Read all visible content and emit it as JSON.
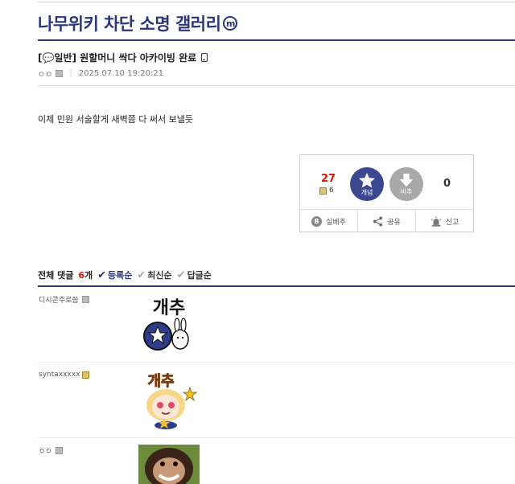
{
  "gallery": {
    "title": "나무위키 차단 소명 갤러리",
    "minor_badge": "m"
  },
  "post": {
    "title": "[💬일반] 원할머니 싹다 아카이빙 완료",
    "author": "ㅇㅇ",
    "date": "2025.07.10 19:20:21",
    "body": "이제 민원 서술할게 새벽쯤 다 써서 보낼듯"
  },
  "vote": {
    "up_count": "27",
    "fix_count": "6",
    "up_label": "개념",
    "down_label": "비추",
    "down_count": "0",
    "actions": [
      "실베추",
      "공유",
      "신고"
    ],
    "bestcheck_letter": "B"
  },
  "comments": {
    "total_label": "전체 댓글",
    "count": "6",
    "count_suffix": "개",
    "sort_options": [
      "등록순",
      "최신순",
      "답글순"
    ],
    "items": [
      {
        "author": "디시콘주로씀",
        "sticker_text": "개추"
      },
      {
        "author": "syntaxxxxx",
        "sticker_text": "개추"
      },
      {
        "author": "ㅇㅇ",
        "sticker_text": ""
      }
    ]
  },
  "icons": {
    "mobile": "mobile-icon",
    "gonick": "gonick-icon",
    "fixnick": "fixnick-icon",
    "share": "share-icon",
    "report": "siren-icon",
    "check": "check-icon"
  },
  "colors": {
    "accent": "#29367c",
    "up": "#3b4890",
    "down": "#a9a9a9",
    "count_red": "#d31900"
  }
}
